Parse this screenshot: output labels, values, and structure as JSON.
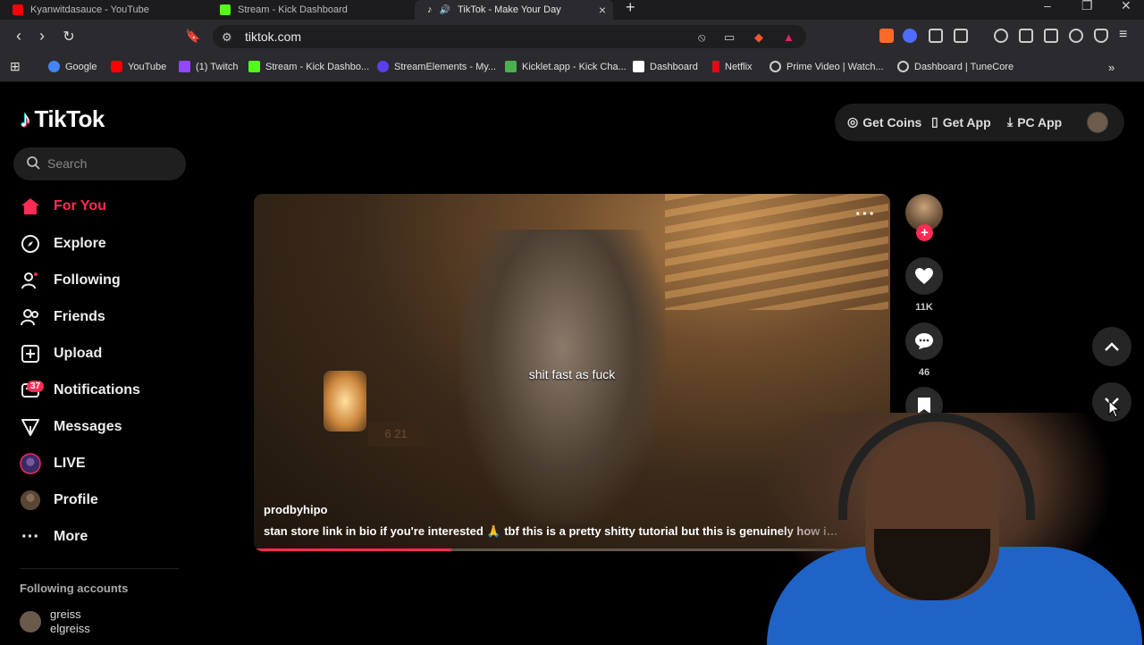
{
  "browser": {
    "tabs": [
      {
        "title": "Kyanwitdasauce - YouTube",
        "favicon_color": "#ff0000"
      },
      {
        "title": "Stream - Kick Dashboard",
        "favicon_color": "#53fc18"
      },
      {
        "title": "TikTok - Make Your Day",
        "favicon_color": "#ffffff"
      }
    ],
    "url": "tiktok.com",
    "bookmarks": [
      {
        "label": "Google",
        "color": "#4285f4"
      },
      {
        "label": "YouTube",
        "color": "#ff0000"
      },
      {
        "label": "(1) Twitch",
        "color": "#9146ff"
      },
      {
        "label": "Stream - Kick Dashbo...",
        "color": "#53fc18"
      },
      {
        "label": "StreamElements - My...",
        "color": "#5a3ff0"
      },
      {
        "label": "Kicklet.app - Kick Cha...",
        "color": "#4caf50"
      },
      {
        "label": "Dashboard",
        "color": "#ffffff"
      },
      {
        "label": "Netflix",
        "color": "#e50914"
      },
      {
        "label": "Prime Video | Watch...",
        "color": "#cccccc"
      },
      {
        "label": "Dashboard | TuneCore",
        "color": "#cccccc"
      }
    ]
  },
  "tiktok": {
    "logo": "TikTok",
    "search_placeholder": "Search",
    "nav": [
      {
        "label": "For You",
        "icon": "home-icon"
      },
      {
        "label": "Explore",
        "icon": "compass-icon"
      },
      {
        "label": "Following",
        "icon": "following-icon"
      },
      {
        "label": "Friends",
        "icon": "friends-icon"
      },
      {
        "label": "Upload",
        "icon": "upload-icon"
      },
      {
        "label": "Notifications",
        "icon": "notifications-icon"
      },
      {
        "label": "Messages",
        "icon": "messages-icon"
      },
      {
        "label": "LIVE",
        "icon": "live-icon"
      },
      {
        "label": "Profile",
        "icon": "profile-icon"
      },
      {
        "label": "More",
        "icon": "more-icon"
      }
    ],
    "notifications_count": "37",
    "following_accounts_title": "Following accounts",
    "following_account": {
      "name": "greiss",
      "handle": "elgreiss"
    },
    "header": {
      "get_coins": "Get Coins",
      "get_app": "Get App",
      "pc_app": "PC App"
    },
    "video": {
      "caption": "shit fast as fuck",
      "author": "prodbyhipo",
      "description": "stan store link in bio if you're interested 🙏  tbf this is a pretty shitty tutorial  but this is genuinely how i col...",
      "progress": 0.31,
      "likes": "11K",
      "comments": "46"
    },
    "accent": "#fe2c55"
  }
}
